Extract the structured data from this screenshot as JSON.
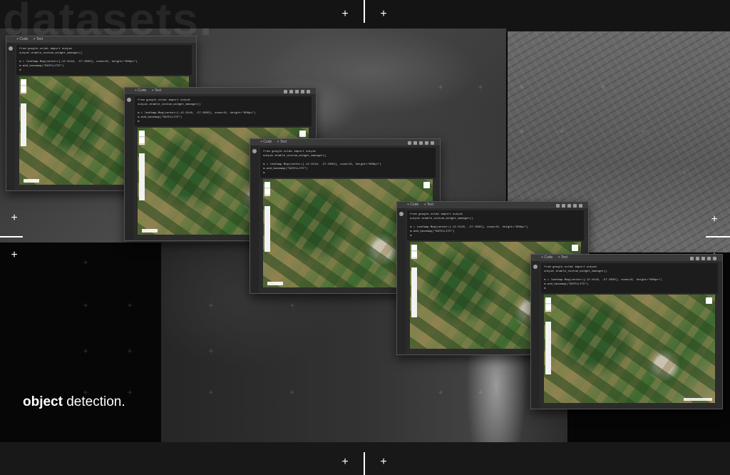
{
  "watermark": "datasets.",
  "caption": {
    "bold": "object",
    "regular": "detection."
  },
  "notebook": {
    "tabs": [
      "+ Code",
      "+ Text"
    ],
    "code_lines": [
      "from google.colab import output",
      "output.enable_custom_widget_manager()",
      "",
      "m = leafmap.Map(center=[-12.0116, -57.0030], zoom=15, height=\"800px\")",
      "m.add_basemap(\"SATELLITE\")",
      "m"
    ]
  },
  "icons": {
    "crosshair": "plus-marker-icon",
    "run": "play-cell-icon",
    "layers": "layers-icon"
  },
  "colors": {
    "background": "#060606",
    "accent": "#ffffff"
  }
}
